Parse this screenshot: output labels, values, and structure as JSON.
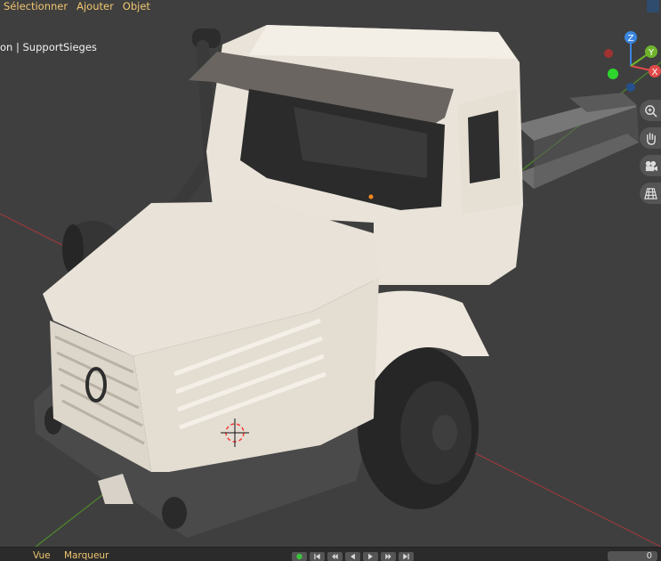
{
  "header": {
    "menu": [
      "Sélectionner",
      "Ajouter",
      "Objet"
    ]
  },
  "viewport": {
    "object_info": "on | SupportSieges"
  },
  "gizmo": {
    "z_label": "Z",
    "y_label": "Y",
    "x_label": "X"
  },
  "timeline": {
    "menu": [
      "Vue",
      "Marqueur"
    ],
    "frame": "0"
  },
  "colors": {
    "menu_text": "#f0c66e",
    "axis_x": "#e04a4a",
    "axis_y": "#6fb32c",
    "axis_z": "#3a86e0",
    "viewport_bg": "#3f3f3f"
  }
}
